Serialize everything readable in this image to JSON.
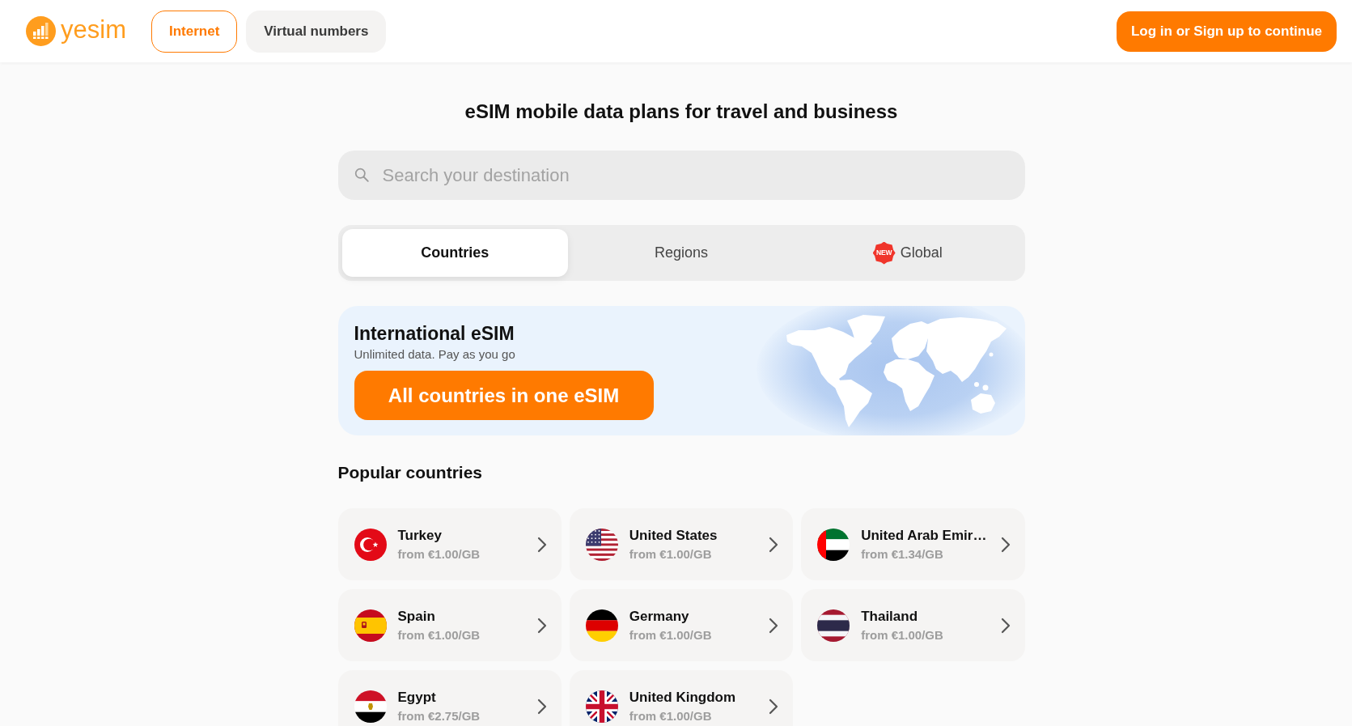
{
  "header": {
    "logo": {
      "text": "yesim"
    },
    "nav": [
      {
        "label": "Internet",
        "selected": true
      },
      {
        "label": "Virtual numbers",
        "selected": false
      }
    ],
    "login_button": "Log in or Sign up to continue"
  },
  "page_title": "eSIM mobile data plans for travel and business",
  "search": {
    "placeholder": "Search your destination"
  },
  "tabs": [
    {
      "label": "Countries",
      "selected": true
    },
    {
      "label": "Regions",
      "selected": false
    },
    {
      "label": "Global",
      "selected": false,
      "badge": "NEW"
    }
  ],
  "promo": {
    "title": "International eSIM",
    "subtitle": "Unlimited data. Pay as you go",
    "button": "All countries in one eSIM"
  },
  "popular": {
    "heading": "Popular countries",
    "countries": [
      {
        "kind": "tr",
        "name": "Turkey",
        "price": "from €1.00/GB"
      },
      {
        "kind": "us",
        "name": "United States",
        "price": "from €1.00/GB"
      },
      {
        "kind": "ae",
        "name": "United Arab Emir…",
        "price": "from €1.34/GB"
      },
      {
        "kind": "es",
        "name": "Spain",
        "price": "from €1.00/GB"
      },
      {
        "kind": "de",
        "name": "Germany",
        "price": "from €1.00/GB"
      },
      {
        "kind": "th",
        "name": "Thailand",
        "price": "from €1.00/GB"
      },
      {
        "kind": "eg",
        "name": "Egypt",
        "price": "from €2.75/GB"
      },
      {
        "kind": "gb",
        "name": "United Kingdom",
        "price": "from €1.00/GB"
      }
    ]
  }
}
